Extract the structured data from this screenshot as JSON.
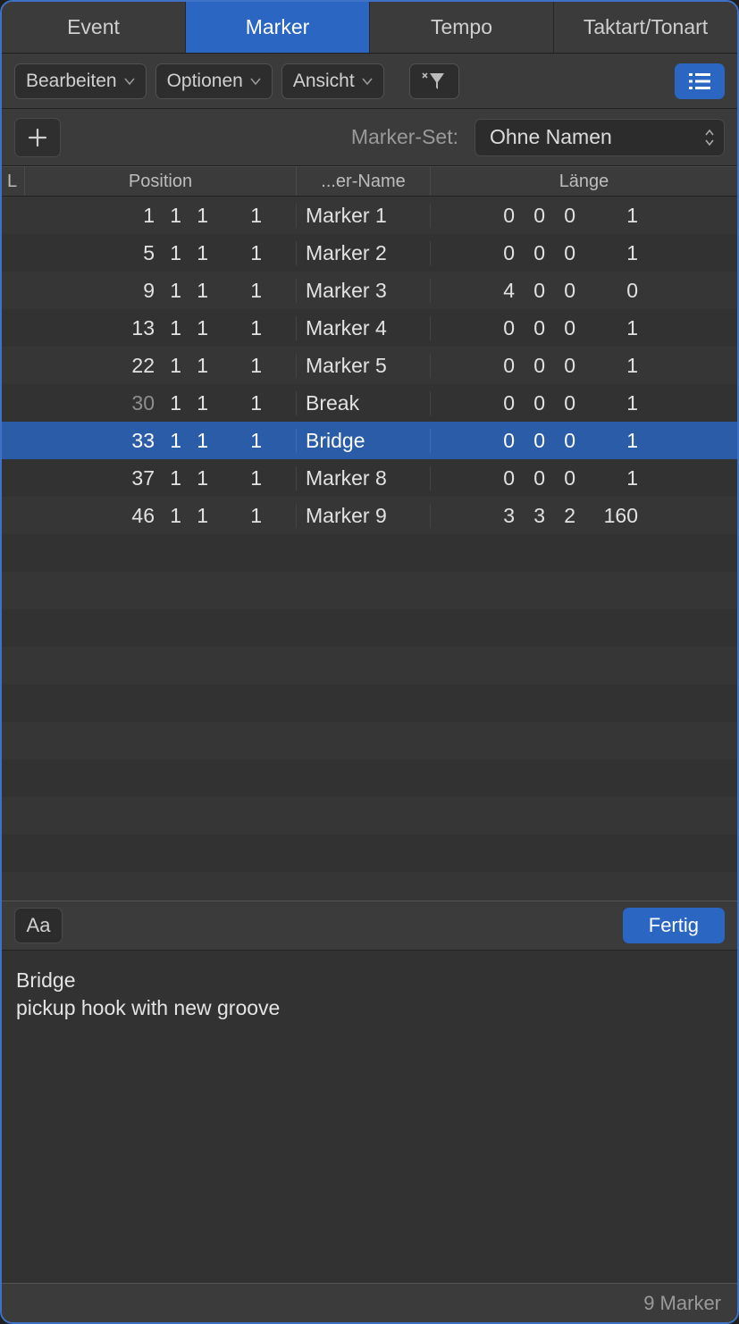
{
  "tabs": [
    {
      "label": "Event",
      "active": false
    },
    {
      "label": "Marker",
      "active": true
    },
    {
      "label": "Tempo",
      "active": false
    },
    {
      "label": "Taktart/Tonart",
      "active": false
    }
  ],
  "toolbar": {
    "edit": "Bearbeiten",
    "options": "Optionen",
    "view": "Ansicht"
  },
  "setrow": {
    "label": "Marker-Set:",
    "selected": "Ohne Namen"
  },
  "headers": {
    "l": "L",
    "position": "Position",
    "name": "...er-Name",
    "length": "Länge"
  },
  "rows": [
    {
      "bar": "1",
      "beat": "1",
      "div": "1",
      "tick": "1",
      "barDim": false,
      "name": "Marker 1",
      "la": "0",
      "lb": "0",
      "lc": "0",
      "ld": "1",
      "selected": false
    },
    {
      "bar": "5",
      "beat": "1",
      "div": "1",
      "tick": "1",
      "barDim": false,
      "name": "Marker 2",
      "la": "0",
      "lb": "0",
      "lc": "0",
      "ld": "1",
      "selected": false
    },
    {
      "bar": "9",
      "beat": "1",
      "div": "1",
      "tick": "1",
      "barDim": false,
      "name": "Marker 3",
      "la": "4",
      "lb": "0",
      "lc": "0",
      "ld": "0",
      "selected": false
    },
    {
      "bar": "13",
      "beat": "1",
      "div": "1",
      "tick": "1",
      "barDim": false,
      "name": "Marker 4",
      "la": "0",
      "lb": "0",
      "lc": "0",
      "ld": "1",
      "selected": false
    },
    {
      "bar": "22",
      "beat": "1",
      "div": "1",
      "tick": "1",
      "barDim": false,
      "name": "Marker 5",
      "la": "0",
      "lb": "0",
      "lc": "0",
      "ld": "1",
      "selected": false
    },
    {
      "bar": "30",
      "beat": "1",
      "div": "1",
      "tick": "1",
      "barDim": true,
      "name": "Break",
      "la": "0",
      "lb": "0",
      "lc": "0",
      "ld": "1",
      "selected": false
    },
    {
      "bar": "33",
      "beat": "1",
      "div": "1",
      "tick": "1",
      "barDim": false,
      "name": "Bridge",
      "la": "0",
      "lb": "0",
      "lc": "0",
      "ld": "1",
      "selected": true
    },
    {
      "bar": "37",
      "beat": "1",
      "div": "1",
      "tick": "1",
      "barDim": false,
      "name": "Marker 8",
      "la": "0",
      "lb": "0",
      "lc": "0",
      "ld": "1",
      "selected": false
    },
    {
      "bar": "46",
      "beat": "1",
      "div": "1",
      "tick": "1",
      "barDim": false,
      "name": "Marker 9",
      "la": "3",
      "lb": "3",
      "lc": "2",
      "ld": "160",
      "selected": false
    }
  ],
  "notesBar": {
    "aa": "Aa",
    "done": "Fertig"
  },
  "notes": "Bridge\npickup hook with new groove",
  "status": "9 Marker",
  "emptyRowCount": 10
}
